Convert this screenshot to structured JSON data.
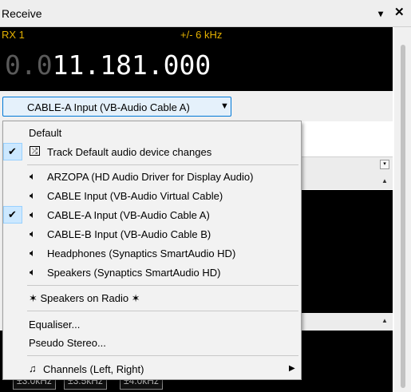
{
  "window": {
    "title": "Receive",
    "pin_glyph": "▾",
    "close_glyph": "✕"
  },
  "display": {
    "rx_label": "RX 1",
    "bandwidth": "+/- 6 kHz",
    "freq_dim": "0.0",
    "freq_main": "11.181.000"
  },
  "device_selector": {
    "value": "CABLE-A Input (VB-Audio Cable A)",
    "arrow_glyph": "▼"
  },
  "background": {
    "bw_buttons": [
      "±3.0kHz",
      "±3.5kHz",
      "±4.0kHz"
    ],
    "mini_button_glyph": "▾",
    "arrow_up_glyph": "▲"
  },
  "menu": {
    "default_label": "Default",
    "track_default": {
      "label": "Track Default audio device changes",
      "checked": true
    },
    "devices": [
      {
        "label": "ARZOPA (HD Audio Driver for Display Audio)",
        "checked": false
      },
      {
        "label": "CABLE Input (VB-Audio Virtual Cable)",
        "checked": false
      },
      {
        "label": "CABLE-A Input (VB-Audio Cable A)",
        "checked": true
      },
      {
        "label": "CABLE-B Input (VB-Audio Cable B)",
        "checked": false
      },
      {
        "label": "Headphones (Synaptics SmartAudio HD)",
        "checked": false
      },
      {
        "label": "Speakers (Synaptics SmartAudio HD)",
        "checked": false
      }
    ],
    "speakers_on_radio": "✶ Speakers on Radio ✶",
    "equaliser": "Equaliser...",
    "pseudo_stereo": "Pseudo Stereo...",
    "channels": "Channels (Left, Right)",
    "check_glyph": "✔",
    "speaker_icon": "speaker-icon",
    "note_icon": "music-note-icon",
    "shuffle_icon": "shuffle-icon"
  }
}
